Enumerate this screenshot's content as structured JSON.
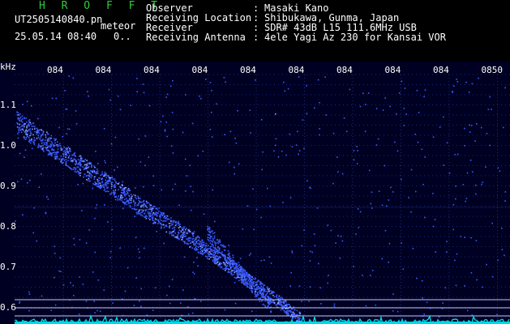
{
  "header": {
    "title": "H R O F F T",
    "filename": "UT2505140840.pn",
    "mode": "meteor",
    "datetime": "25.05.14 08:40",
    "datetime_extra": "0..",
    "info": [
      {
        "label": "Observer",
        "value": "Masaki Kano"
      },
      {
        "label": "Receiving Location",
        "value": "Shibukawa, Gunma, Japan"
      },
      {
        "label": "Receiver",
        "value": "SDR# 43dB L15 111.6MHz USB"
      },
      {
        "label": "Receiving Antenna",
        "value": "4ele Yagi Az 230 for Kansai VOR"
      }
    ]
  },
  "spectrogram": {
    "y_unit": "kHz",
    "y_ticks": [
      "1.1",
      "1.0",
      "0.9",
      "0.8",
      "0.7",
      "0.6"
    ],
    "x_ticks": [
      "084",
      "084",
      "084",
      "084",
      "084",
      "084",
      "084",
      "084",
      "084",
      "0850"
    ],
    "background": "#000022",
    "grid_color": "#1c2a78",
    "signal_color": "#3b5bff",
    "line_color": "#c9c9ff",
    "noise_color": "#00d8e8"
  }
}
